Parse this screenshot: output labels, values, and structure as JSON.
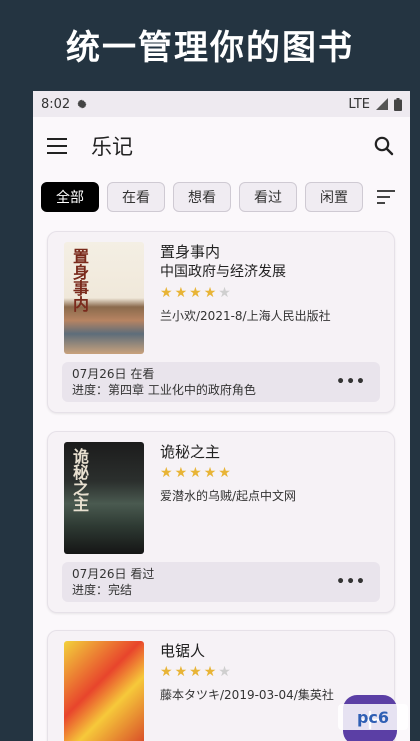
{
  "promo": {
    "headline": "统一管理你的图书"
  },
  "status": {
    "time": "8:02",
    "network": "LTE"
  },
  "appbar": {
    "title": "乐记"
  },
  "filters": [
    "全部",
    "在看",
    "想看",
    "看过",
    "闲置"
  ],
  "books": [
    {
      "cover_text": "置身事内",
      "title": "置身事内",
      "subtitle": "中国政府与经济发展",
      "rating": 4,
      "meta": "兰小欢/2021-8/上海人民出版社",
      "status_line": "07月26日 在看",
      "progress_line": "进度：第四章 工业化中的政府角色"
    },
    {
      "cover_text": "诡秘之主",
      "title": "诡秘之主",
      "subtitle": "",
      "rating": 5,
      "meta": "爱潜水的乌贼/起点中文网",
      "status_line": "07月26日 看过",
      "progress_line": "进度：完结"
    },
    {
      "cover_text": "",
      "title": "电锯人",
      "subtitle": "",
      "rating": 4,
      "meta": "藤本タツキ/2019-03-04/集英社",
      "status_line": "",
      "progress_line": ""
    }
  ],
  "watermark": "pc6"
}
